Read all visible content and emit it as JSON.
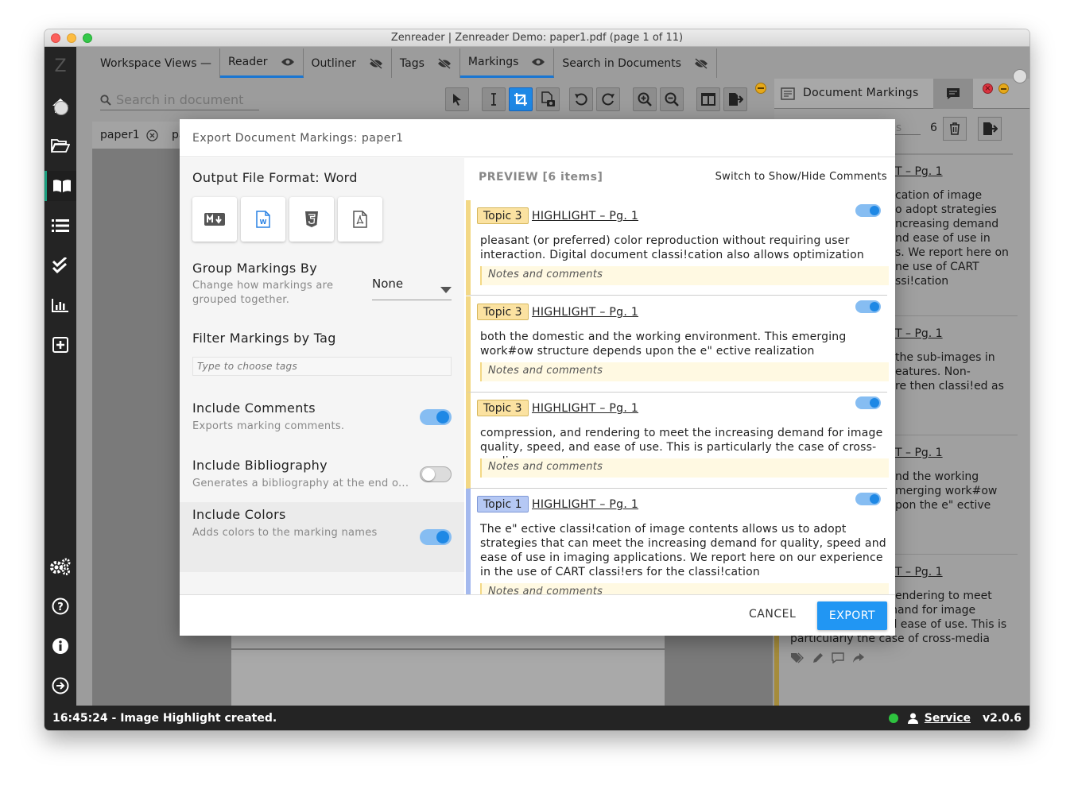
{
  "window": {
    "title": "Zenreader | Zenreader Demo: paper1.pdf (page 1 of 11)"
  },
  "sidebar": {
    "logo": "Z",
    "icons": [
      "home-icon",
      "folder-open-icon",
      "book-icon",
      "list-icon",
      "check-double-icon",
      "bar-chart-icon",
      "plus-square-icon",
      "gears-icon",
      "help-icon",
      "info-icon",
      "logout-icon"
    ]
  },
  "tabs": [
    {
      "label": "Workspace Views —"
    },
    {
      "label": "Reader"
    },
    {
      "label": "Outliner"
    },
    {
      "label": "Tags"
    },
    {
      "label": "Markings"
    },
    {
      "label": "Search in Documents"
    }
  ],
  "search": {
    "placeholder": "Search in document"
  },
  "doc_tabs": [
    {
      "label": "paper1"
    },
    {
      "label": "pa"
    }
  ],
  "right_panel": {
    "title": "Document Markings",
    "filter_placeholder": "gs",
    "count": "6",
    "cards": [
      {
        "header": "T – Pg. 1",
        "lines": [
          "cation of image",
          "o adopt strategies",
          "ncreasing demand",
          "nd ease of use in",
          "s. We report here on",
          "ne use of CART",
          "ssi!cation"
        ]
      },
      {
        "header": "T – Pg. 1",
        "lines": [
          "the sub-images in",
          "eatures. Non-",
          "re then classi!ed as"
        ]
      },
      {
        "header": "T – Pg. 1",
        "lines": [
          "nd the working",
          "merging work#ow",
          "pon the e\" ective"
        ]
      },
      {
        "header": "T – Pg. 1",
        "lines": [
          "endering to meet"
        ],
        "full_lines": [
          "the increasing demand for image",
          "quality, speed, and ease of use. This is",
          "particularly the case of cross-media"
        ]
      }
    ]
  },
  "status": {
    "message": "16:45:24 - Image Highlight created.",
    "user": "Service",
    "version": "v2.0.6",
    "dot_color": "#2ec23f"
  },
  "modal": {
    "title": "Export Document Markings: paper1",
    "output_label": "Output File Format: Word",
    "formats": [
      {
        "icon": "markdown-icon"
      },
      {
        "icon": "word-icon",
        "selected": true
      },
      {
        "icon": "html5-icon"
      },
      {
        "icon": "pdf-icon"
      }
    ],
    "group_by": {
      "label": "Group Markings By",
      "desc": "Change how markings are grouped together.",
      "value": "None"
    },
    "filter": {
      "label": "Filter Markings by Tag",
      "placeholder": "Type to choose tags"
    },
    "include_comments": {
      "label": "Include Comments",
      "desc": "Exports marking comments.",
      "on": true
    },
    "include_bibliography": {
      "label": "Include Bibliography",
      "desc": "Generates a bibliography at the end o...",
      "on": false
    },
    "include_colors": {
      "label": "Include Colors",
      "desc": "Adds colors to the marking names",
      "on": true
    },
    "preview": {
      "title": "PREVIEW [6 items]",
      "switch_label": "Switch to Show/Hide Comments",
      "items": [
        {
          "tag": "Topic 3",
          "type": "HIGHLIGHT – Pg. 1",
          "text": "pleasant (or preferred) color reproduction without requiring user interaction. Digital document classi!cation also allows optimization",
          "notes": "Notes and comments"
        },
        {
          "tag": "Topic 3",
          "type": "HIGHLIGHT – Pg. 1",
          "text": "both the domestic and the working environment. This emerging work#ow structure depends upon the e\" ective realization",
          "notes": "Notes and comments"
        },
        {
          "tag": "Topic 3",
          "type": "HIGHLIGHT – Pg. 1",
          "text": "compression, and rendering to meet the increasing demand for image quality, speed, and ease of use. This is particularly the case of cross-media",
          "notes": "Notes and comments"
        },
        {
          "tag": "Topic 1",
          "type": "HIGHLIGHT – Pg. 1",
          "text": "The e\" ective classi!cation of image contents allows us to adopt strategies that can meet the increasing demand for quality, speed and ease of use in imaging applications. We report here on our experience in the use of CART classi!ers for the classi!cation",
          "notes": "Notes and comments"
        }
      ]
    },
    "cancel_label": "CANCEL",
    "export_label": "EXPORT"
  }
}
